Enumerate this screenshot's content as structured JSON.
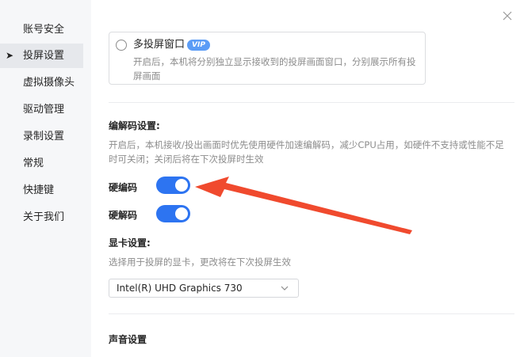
{
  "sidebar": {
    "items": [
      {
        "label": "账号安全",
        "active": false
      },
      {
        "label": "投屏设置",
        "active": true
      },
      {
        "label": "虚拟摄像头",
        "active": false
      },
      {
        "label": "驱动管理",
        "active": false
      },
      {
        "label": "录制设置",
        "active": false
      },
      {
        "label": "常规",
        "active": false
      },
      {
        "label": "快捷键",
        "active": false
      },
      {
        "label": "关于我们",
        "active": false
      }
    ],
    "active_marker": "➤"
  },
  "multi_cast": {
    "title": "多投屏窗口",
    "badge": "VIP",
    "description": "开启后，本机将分别独立显示接收到的投屏画面窗口，分别展示所有投屏画面",
    "checked": false
  },
  "codec": {
    "title": "编解码设置:",
    "description": "开启后，本机接收/投出画面时优先使用硬件加速编解码，减少CPU占用，如硬件不支持或性能不足时可关闭；关闭后将在下次投屏时生效",
    "hw_encode": {
      "label": "硬编码",
      "enabled": true
    },
    "hw_decode": {
      "label": "硬解码",
      "enabled": true
    }
  },
  "gpu": {
    "title": "显卡设置:",
    "description": "选择用于投屏的显卡，更改将在下次投屏生效",
    "selected": "Intel(R) UHD Graphics 730"
  },
  "audio": {
    "title": "声音设置"
  },
  "colors": {
    "accent": "#2d74f1",
    "vip": "#5b9cf6",
    "annotation_arrow": "#f04a2e"
  },
  "icons": {
    "close": "close-icon",
    "chevron": "chevron-down-icon",
    "annotation": "red-arrow"
  }
}
